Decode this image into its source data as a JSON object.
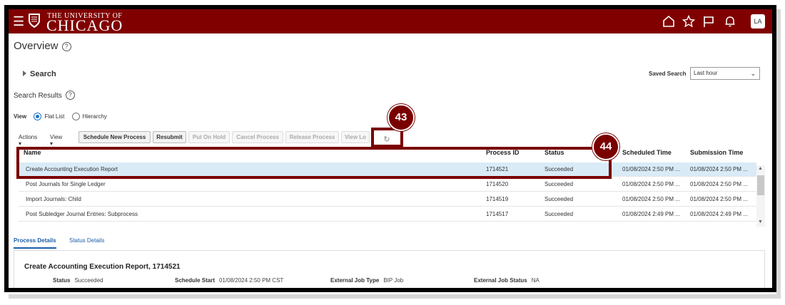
{
  "header": {
    "university_line1": "THE UNIVERSITY OF",
    "university_line2": "CHICAGO",
    "avatar": "LA",
    "icons": [
      "menu-icon",
      "home-icon",
      "star-icon",
      "flag-icon",
      "bell-icon"
    ],
    "brand_color": "#800000"
  },
  "page": {
    "title": "Overview",
    "search_label": "Search",
    "saved_search_label": "Saved Search",
    "saved_search_value": "Last hour",
    "search_results_label": "Search Results"
  },
  "view": {
    "label": "View",
    "options": [
      {
        "label": "Flat List",
        "selected": true
      },
      {
        "label": "Hierarchy",
        "selected": false
      }
    ]
  },
  "toolbar": {
    "actions_label": "Actions",
    "view_label": "View",
    "buttons": [
      {
        "label": "Schedule New Process",
        "enabled": true
      },
      {
        "label": "Resubmit",
        "enabled": true
      },
      {
        "label": "Put On Hold",
        "enabled": false
      },
      {
        "label": "Cancel Process",
        "enabled": false
      },
      {
        "label": "Release Process",
        "enabled": false
      },
      {
        "label": "View Lo",
        "enabled": false
      }
    ]
  },
  "table": {
    "columns": [
      "Name",
      "Process ID",
      "Status",
      "Scheduled Time",
      "Submission Time"
    ],
    "rows": [
      {
        "name": "Create Accounting Execution Report",
        "process_id": "1714521",
        "status": "Succeeded",
        "scheduled": "01/08/2024 2:50 PM ...",
        "submitted": "01/08/2024 2:50 PM ...",
        "selected": true
      },
      {
        "name": "Post Journals for Single Ledger",
        "process_id": "1714520",
        "status": "Succeeded",
        "scheduled": "01/08/2024 2:50 PM ...",
        "submitted": "01/08/2024 2:50 PM ...",
        "selected": false
      },
      {
        "name": "Import Journals: Child",
        "process_id": "1714519",
        "status": "Succeeded",
        "scheduled": "01/08/2024 2:50 PM ...",
        "submitted": "01/08/2024 2:50 PM ...",
        "selected": false
      },
      {
        "name": "Post Subledger Journal Entries: Subprocess",
        "process_id": "1714517",
        "status": "Succeeded",
        "scheduled": "01/08/2024 2:49 PM ...",
        "submitted": "01/08/2024 2:49 PM ...",
        "selected": false
      }
    ]
  },
  "details": {
    "tabs": [
      "Process Details",
      "Status Details"
    ],
    "title": "Create Accounting Execution Report, 1714521",
    "fields": [
      {
        "label": "Status",
        "value": "Succeeded"
      },
      {
        "label": "Schedule Start",
        "value": "01/08/2024 2:50 PM CST"
      },
      {
        "label": "External Job Type",
        "value": "BIP Job"
      },
      {
        "label": "External Job Status",
        "value": "NA"
      }
    ]
  },
  "annotations": {
    "step_refresh": "43",
    "step_row": "44",
    "color": "#7a0000"
  }
}
